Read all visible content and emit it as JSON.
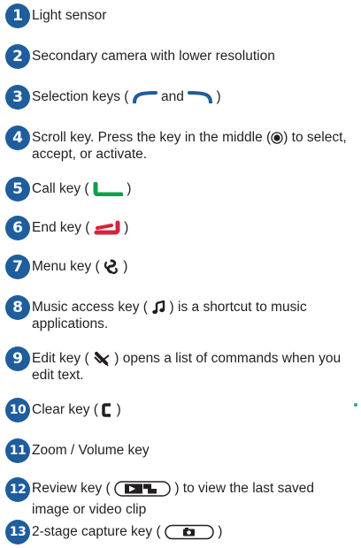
{
  "items": [
    {
      "number": "1",
      "text": "Light sensor"
    },
    {
      "number": "2",
      "text": "Secondary camera with lower resolution"
    },
    {
      "number": "3",
      "before": "Selection keys (",
      "middle": "and",
      "after": ")"
    },
    {
      "number": "4",
      "before": "Scroll key. Press the key in the middle (",
      "after": ") to select, accept, or activate."
    },
    {
      "number": "5",
      "before": "Call key (",
      "after": ")"
    },
    {
      "number": "6",
      "before": "End key (",
      "after": ")"
    },
    {
      "number": "7",
      "before": "Menu key (",
      "after": ")"
    },
    {
      "number": "8",
      "before": "Music access key (",
      "after": ") is a shortcut to music applications."
    },
    {
      "number": "9",
      "before": "Edit key (",
      "after": ") opens a list of commands when you edit text."
    },
    {
      "number": "10",
      "before": "Clear key (",
      "after": ")"
    },
    {
      "number": "11",
      "text": "Zoom / Volume key"
    },
    {
      "number": "12",
      "before": "Review key (",
      "after": ") to view the last saved image or video clip"
    },
    {
      "number": "13",
      "before": "2-stage capture key (",
      "after": ")"
    }
  ],
  "colors": {
    "badge": "#1f5d9c",
    "call_green": "#0ea04b",
    "end_red": "#d6233a",
    "selection_blue": "#1f5d9c",
    "text": "#231f20"
  },
  "icons": {
    "selection_left": "left-selection-key-icon",
    "selection_right": "right-selection-key-icon",
    "scroll_middle": "scroll-middle-icon",
    "call": "call-key-icon",
    "end": "end-key-icon",
    "menu": "menu-key-icon",
    "music": "music-note-icon",
    "edit": "edit-pencil-icon",
    "clear": "clear-key-icon",
    "review": "review-key-icon",
    "capture": "capture-key-icon"
  }
}
